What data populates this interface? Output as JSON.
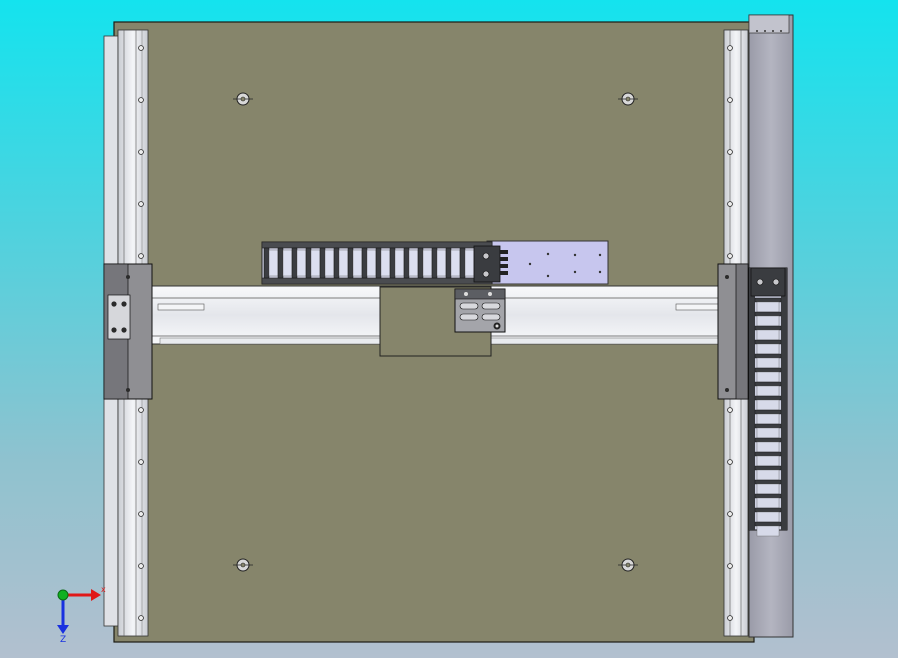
{
  "viewport": {
    "background_top": "#14e3ee",
    "background_bottom": "#b2c0cf"
  },
  "model": {
    "base_plate_color": "#86856b",
    "rail_color": "#e9ebef",
    "gantry_beam_color": "#f0f1f5",
    "bracket_color": "#8f8f93",
    "cable_chain_color": "#2f3133",
    "mount_plate_color": "#c7c6ee",
    "side_profile_color": "#a9aab6"
  },
  "triad": {
    "axis_z_label": "Z",
    "x_color": "#e01818",
    "y_color": "#10b020",
    "z_color": "#1830e0"
  }
}
